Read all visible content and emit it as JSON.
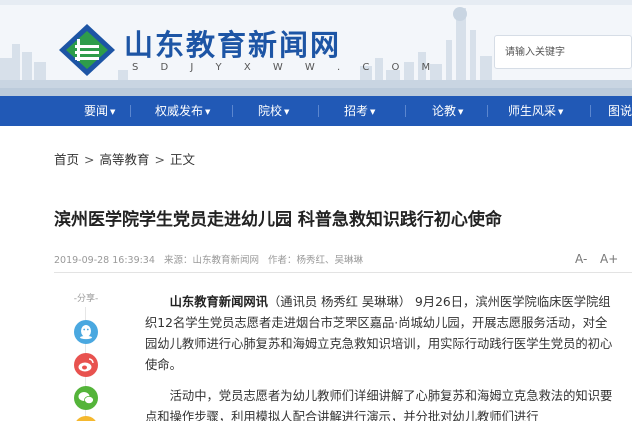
{
  "header": {
    "site_title": "山东教育新闻网",
    "site_domain": "S D J Y X W W . C O M",
    "search_placeholder": "请输入关键字",
    "logo_icon": "sdjyxww-logo-icon"
  },
  "nav": {
    "items": [
      {
        "label": "要闻",
        "caret": "▼"
      },
      {
        "label": "权威发布",
        "caret": "▼"
      },
      {
        "label": "院校",
        "caret": "▼"
      },
      {
        "label": "招考",
        "caret": "▼"
      },
      {
        "label": "论教",
        "caret": "▼"
      },
      {
        "label": "师生风采",
        "caret": "▼"
      },
      {
        "label": "图说",
        "caret": ""
      }
    ]
  },
  "breadcrumb": {
    "home": "首页",
    "category": "高等教育",
    "current": "正文",
    "separator": ">"
  },
  "article": {
    "title": "滨州医学院学生党员走进幼儿园 科普急救知识践行初心使命",
    "date": "2019-09-28 16:39:34",
    "source": "来源：山东教育新闻网",
    "author": "作者：杨秀红、吴琳琳",
    "font_smaller": "A-",
    "font_larger": "A+",
    "p1_lead": "山东教育新闻网讯",
    "p1_rest": "（通讯员 杨秀红  吴琳琳） 9月26日，滨州医学院临床医学院组织12名学生党员志愿者走进烟台市芝罘区嘉品·尚城幼儿园，开展志愿服务活动，对全园幼儿教师进行心肺复苏和海姆立克急救知识培训，用实际行动践行医学生党员的初心使命。",
    "p2": "活动中，党员志愿者为幼儿教师们详细讲解了心肺复苏和海姆立克急救法的知识要点和操作步骤，利用模拟人配合讲解进行演示，并分批对幼儿教师们进行"
  },
  "share": {
    "label": "-分享-",
    "icons": [
      "qq-icon",
      "weibo-icon",
      "wechat-icon",
      "qzone-icon"
    ]
  },
  "colors": {
    "brand_blue": "#2159b6",
    "title_blue": "#1d55a5",
    "logo_green": "#2e9c4a",
    "qq": "#4aa8e0",
    "weibo": "#e8524f",
    "wechat": "#54b43a",
    "qzone": "#f5b82e"
  }
}
